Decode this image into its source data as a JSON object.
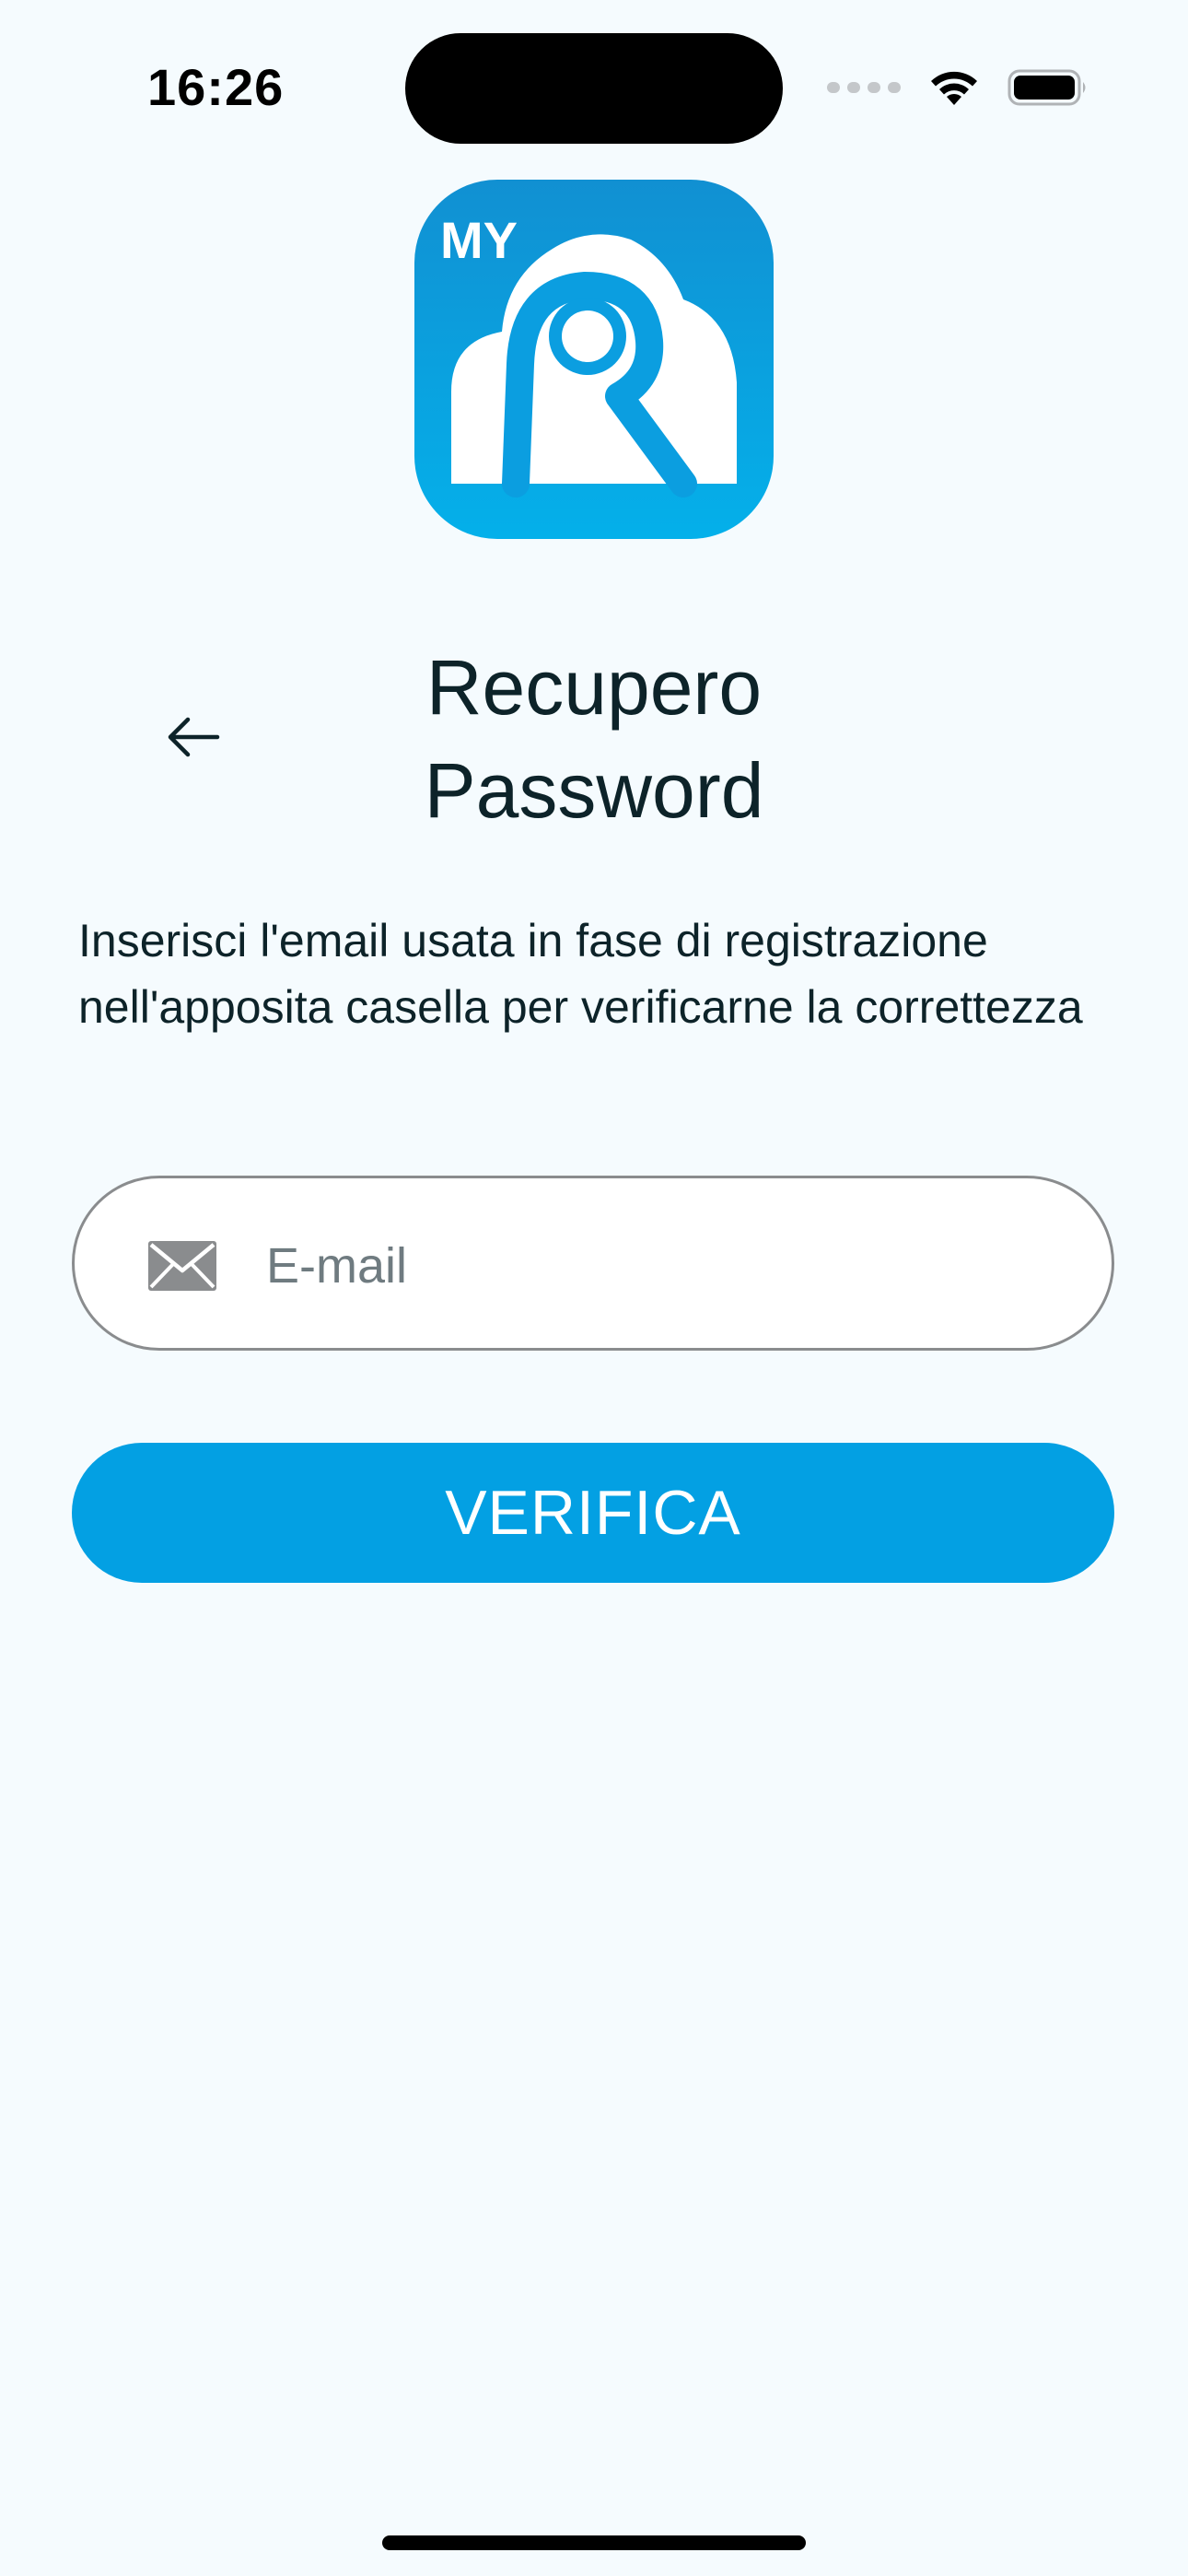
{
  "status_bar": {
    "time": "16:26",
    "icons": [
      "signal-dots-icon",
      "wifi-icon",
      "battery-icon"
    ]
  },
  "logo": {
    "text": "MY",
    "letter": "R",
    "gradient_top": "#1190d2",
    "gradient_bottom": "#04b0ea"
  },
  "header": {
    "back_icon": "arrow-left-icon",
    "title_line1": "Recupero",
    "title_line2": "Password"
  },
  "description": "Inserisci l'email usata in fase di registrazione nell'apposita casella per verificarne la correttezza",
  "form": {
    "email_icon": "envelope-icon",
    "email_value": "",
    "email_placeholder": "E-mail",
    "verify_label": "VERIFICA"
  },
  "colors": {
    "background": "#f5fbfe",
    "accent": "#03a0e3",
    "text": "#0d2329"
  }
}
